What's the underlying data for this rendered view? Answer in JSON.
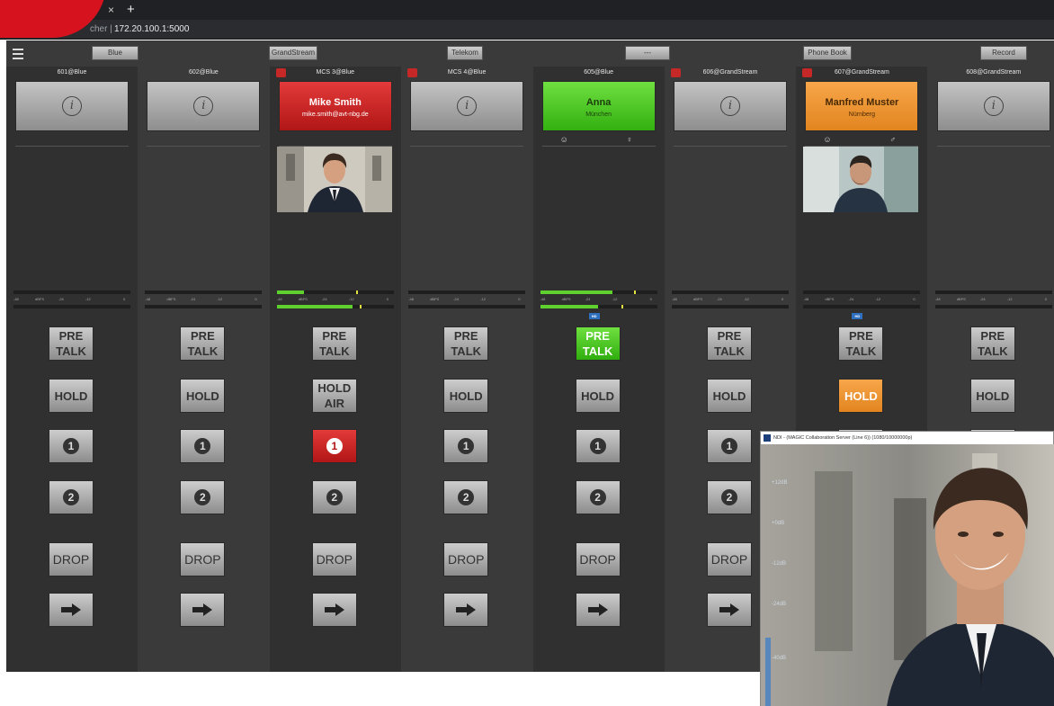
{
  "browser": {
    "tab_close": "×",
    "tab_new": "+",
    "url_site": "cher |",
    "url": "172.20.100.1:5000"
  },
  "groups": [
    "Blue",
    "GrandStream",
    "Telekom",
    "---",
    "Phone Book",
    "Record"
  ],
  "columns": [
    {
      "name": "601@Blue",
      "card": "grey"
    },
    {
      "name": "602@Blue",
      "card": "grey"
    },
    {
      "name": "MCS 3@Blue",
      "card": "red",
      "caller": "Mike Smith",
      "sub": "mike.smith@avt-nbg.de",
      "hold_label": "HOLD AIR",
      "line1_active": true
    },
    {
      "name": "MCS 4@Blue",
      "card": "grey"
    },
    {
      "name": "605@Blue",
      "card": "green",
      "caller": "Anna",
      "sub": "München",
      "pretalk_active": true,
      "hd": "HD"
    },
    {
      "name": "606@GrandStream",
      "card": "grey"
    },
    {
      "name": "607@GrandStream",
      "card": "orange",
      "caller": "Manfred Muster",
      "sub": "Nürnberg",
      "hold_active": true,
      "hd": "HD"
    },
    {
      "name": "608@GrandStream",
      "card": "grey"
    }
  ],
  "buttons": {
    "pretalk": "PRE TALK",
    "hold": "HOLD",
    "line1": "1",
    "line2": "2",
    "drop": "DROP"
  },
  "meter_scale": [
    "-48",
    "dBFS",
    "-24",
    "-12",
    "0"
  ],
  "ndi": {
    "title": "NDI - (MAGIC Collaboration Server (Line 6)) (1080/10000000p)",
    "levels": [
      "+12dB",
      "+0dB",
      "-12dB",
      "-24dB",
      "-40dB"
    ]
  },
  "colors": {
    "red": "#d6121f",
    "green": "#45c51e",
    "orange": "#ee9430",
    "hd": "#2f6fbf"
  }
}
